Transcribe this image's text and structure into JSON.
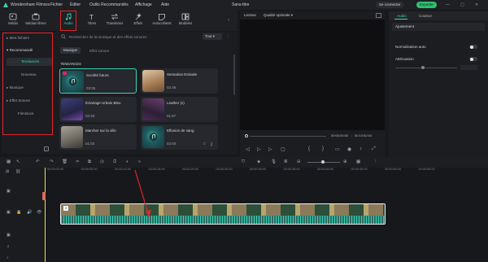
{
  "window": {
    "app_title": "Wondershare Filmora",
    "menu": [
      "Fichier",
      "Éditer",
      "Outils Recommandés",
      "Affichage",
      "Aide"
    ],
    "project_title": "Sans-titre",
    "connect_label": "Se connecter",
    "export_label": "Exporter"
  },
  "toolbar": {
    "tabs": [
      {
        "label": "Média",
        "icon": "media-icon"
      },
      {
        "label": "Médias libres",
        "icon": "stock-media-icon"
      },
      {
        "label": "Audio",
        "icon": "music-note-icon"
      },
      {
        "label": "Titres",
        "icon": "text-icon"
      },
      {
        "label": "Transitions",
        "icon": "transition-icon"
      },
      {
        "label": "Effets",
        "icon": "effects-icon"
      },
      {
        "label": "Autocollants",
        "icon": "sticker-icon"
      },
      {
        "label": "Modèles",
        "icon": "template-icon"
      }
    ],
    "active_tab": "Audio"
  },
  "sidebar": {
    "items": [
      {
        "label": "Mes fichiers",
        "expandable": true
      },
      {
        "label": "Recommandé",
        "expandable": true
      },
      {
        "label": "Tendances",
        "selected": true
      },
      {
        "label": "Nouveau"
      },
      {
        "label": "Musique",
        "expandable": true
      },
      {
        "label": "Effet Sonore",
        "expandable": true
      },
      {
        "label": "Filmstock"
      }
    ]
  },
  "search": {
    "placeholder": "Rechercher de la musique et des effets sonores",
    "filter_label": "Tout"
  },
  "content": {
    "subtabs": [
      "Musique",
      "Effet sonore"
    ],
    "section_title": "TENDANCES",
    "cards": [
      {
        "name": "Société future",
        "duration": "03:05",
        "thumb_color": "#1e5a5e"
      },
      {
        "name": "Sensation Estivale",
        "duration": "02:46",
        "thumb_color": "#c9a27a"
      },
      {
        "name": "Éclairage Urbain Bleu",
        "duration": "02:29",
        "thumb_color": "#2c2c52"
      },
      {
        "name": "Leather (x)",
        "duration": "01:57",
        "thumb_color": "#3a2a44"
      },
      {
        "name": "Marcher sur la ville",
        "duration": "01:04",
        "thumb_color": "#6f6a62"
      },
      {
        "name": "Effusion de sang",
        "duration": "02:50",
        "thumb_color": "#1e5a5e"
      }
    ]
  },
  "preview": {
    "player_label": "Lecteur",
    "quality_label": "Qualité optimale",
    "current_time": "00:00:00:00",
    "total_time": "00:10:52:04"
  },
  "right_panel": {
    "tabs": [
      "Audio",
      "Couleur"
    ],
    "section": "Ajustement",
    "normalization_label": "Normalisation auto",
    "attenuation_label": "Atténuation",
    "reset_label": "Réinitialiser"
  },
  "timeline": {
    "ticks": [
      "00:00:00:00",
      "00:00:05:00",
      "00:00:10:00",
      "00:00:15:00",
      "00:00:20:00",
      "00:00:25:00",
      "00:00:30:00",
      "00:00:35:00",
      "00:00:40:00",
      "00:00:45:00",
      "00:00:50:00",
      "00:00:55:00"
    ],
    "clip_label": "3"
  },
  "colors": {
    "accent": "#3fd1b5",
    "annotation_red": "#e0262a",
    "playhead": "#f0e056",
    "export_green": "#2fbf71"
  }
}
